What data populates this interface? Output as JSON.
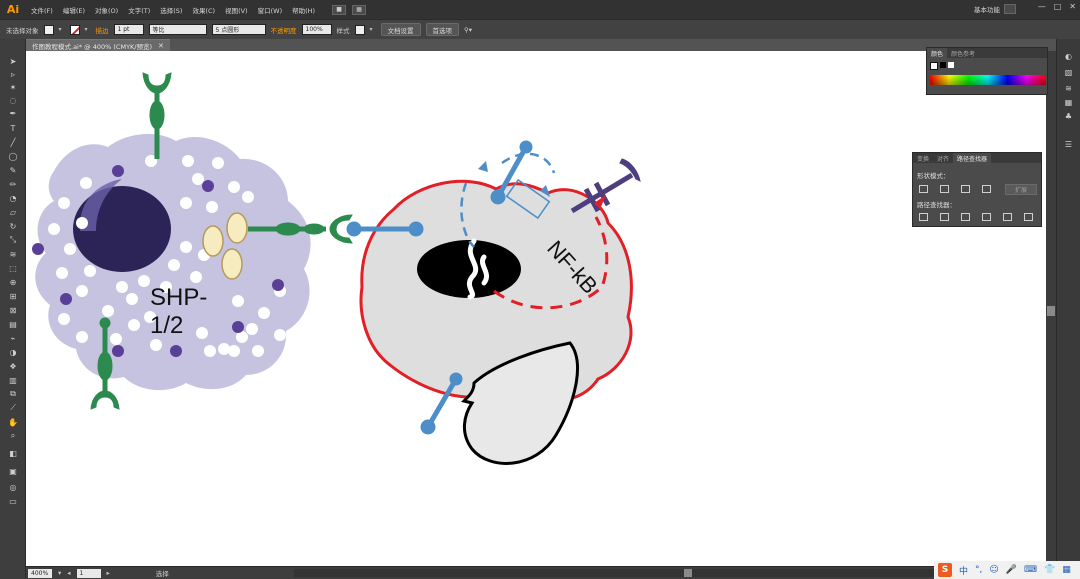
{
  "app": {
    "logo": "Ai"
  },
  "menu": {
    "items": [
      "文件(F)",
      "编辑(E)",
      "对象(O)",
      "文字(T)",
      "选择(S)",
      "效果(C)",
      "视图(V)",
      "窗口(W)",
      "帮助(H)"
    ],
    "workspace": "基本功能",
    "window_controls": [
      "—",
      "□",
      "✕"
    ]
  },
  "control": {
    "selection": "未选择对象",
    "stroke_label": "描边",
    "stroke_width": "1 pt",
    "stroke_style": "等比",
    "brush": "5 点圆形",
    "opacity_label": "不透明度",
    "opacity": "100%",
    "style_label": "样式",
    "doc_setup": "文档设置",
    "preferences": "首选项"
  },
  "document": {
    "tab_title": "作图教程模式.ai* @ 400% (CMYK/预览)",
    "close": "✕"
  },
  "color_panel": {
    "tabs": [
      "颜色",
      "颜色参考"
    ]
  },
  "pathfinder_panel": {
    "tabs": [
      "变换",
      "对齐",
      "路径查找器"
    ],
    "shape_modes_label": "形状模式：",
    "pathfinder_label": "路径查找器：",
    "expand_button": "扩展"
  },
  "artwork": {
    "shp_label_line1": "SHP-",
    "shp_label_line2": "1/2",
    "nfkb_label": "NF-kB"
  },
  "status": {
    "zoom": "400%",
    "page": "1",
    "mode": "选择"
  },
  "tray": {
    "ime": "中",
    "icons": [
      "S",
      "中",
      "°,",
      "☺",
      "🎤",
      "⌨",
      "👕",
      "▦"
    ]
  },
  "colors": {
    "cell_purple": "#c6c3e0",
    "nucleus_dark": "#2c2356",
    "receptor_green": "#2d8a4e",
    "receptor_blue": "#4d8ec8",
    "membrane_red": "#e21f26",
    "granule_purple": "#5a3f96",
    "vesicle_cream": "#f6ecc0"
  }
}
